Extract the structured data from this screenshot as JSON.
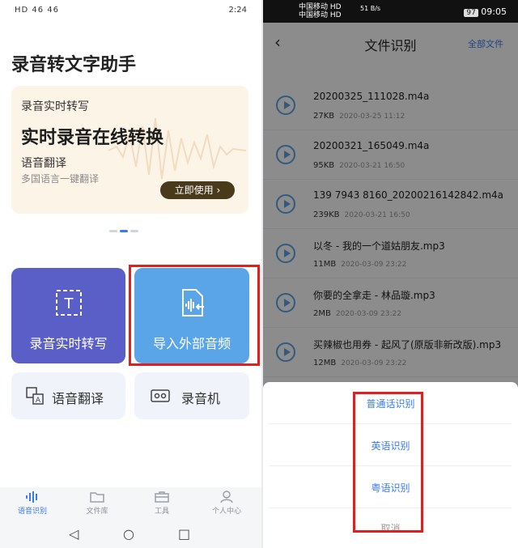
{
  "left": {
    "status": {
      "network": "HD 46 46",
      "time": "2:24"
    },
    "app_title": "录音转文字助手",
    "banner": {
      "subtitle": "录音实时转写",
      "headline": "实时录音在线转换",
      "feature": "语音翻译",
      "feature_desc": "多国语言一键翻译",
      "button": "立即使用"
    },
    "tiles": {
      "live": "录音实时转写",
      "import": "导入外部音频",
      "translate": "语音翻译",
      "recorder": "录音机"
    },
    "tabs": [
      "语音识别",
      "文件库",
      "工具",
      "个人中心"
    ]
  },
  "right": {
    "status": {
      "carrier1": "中国移动 HD",
      "carrier2": "中国移动 HD",
      "speed": "51 B/s",
      "battery": "97",
      "time": "09:05"
    },
    "header": {
      "title": "文件识别",
      "all_files": "全部文件"
    },
    "files": [
      {
        "name": "20200325_111028.m4a",
        "size": "27KB",
        "date": "2020-03-25 11:12"
      },
      {
        "name": "20200321_165049.m4a",
        "size": "95KB",
        "date": "2020-03-21 16:50"
      },
      {
        "name": "139 7943 8160_20200216142842.m4a",
        "size": "239KB",
        "date": "2020-03-21 16:50"
      },
      {
        "name": "以冬 - 我的一个道姑朋友.mp3",
        "size": "11MB",
        "date": "2020-03-09 23:22"
      },
      {
        "name": "你要的全拿走 - 林品璇.mp3",
        "size": "2MB",
        "date": "2020-03-09 23:22"
      },
      {
        "name": "买辣椒也用券 - 起风了(原版非新改版).mp3",
        "size": "12MB",
        "date": "2020-03-09 23:22"
      }
    ],
    "sheet": {
      "options": [
        "普通话识别",
        "英语识别",
        "粤语识别"
      ],
      "cancel": "取消"
    }
  }
}
